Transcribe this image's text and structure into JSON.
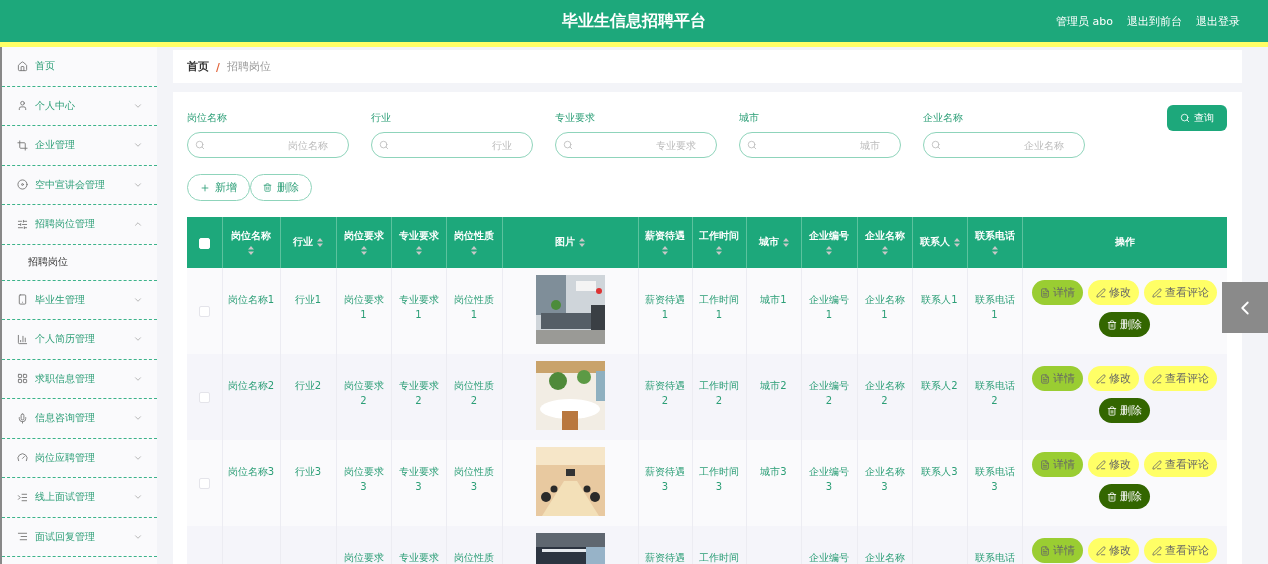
{
  "header": {
    "title": "毕业生信息招聘平台",
    "links": [
      "管理员 abo",
      "退出到前台",
      "退出登录"
    ]
  },
  "sidebar": {
    "items": [
      {
        "label": "首页",
        "kind": "link"
      },
      {
        "label": "个人中心",
        "kind": "group",
        "expanded": false
      },
      {
        "label": "企业管理",
        "kind": "group",
        "expanded": false
      },
      {
        "label": "空中宣讲会管理",
        "kind": "group",
        "expanded": false
      },
      {
        "label": "招聘岗位管理",
        "kind": "group",
        "expanded": true,
        "children": [
          {
            "label": "招聘岗位",
            "selected": true
          }
        ]
      },
      {
        "label": "毕业生管理",
        "kind": "group",
        "expanded": false
      },
      {
        "label": "个人简历管理",
        "kind": "group",
        "expanded": false
      },
      {
        "label": "求职信息管理",
        "kind": "group",
        "expanded": false
      },
      {
        "label": "信息咨询管理",
        "kind": "group",
        "expanded": false
      },
      {
        "label": "岗位应聘管理",
        "kind": "group",
        "expanded": false
      },
      {
        "label": "线上面试管理",
        "kind": "group",
        "expanded": false
      },
      {
        "label": "面试回复管理",
        "kind": "group",
        "expanded": false
      }
    ]
  },
  "breadcrumb": [
    "首页",
    "/",
    "招聘岗位"
  ],
  "search": {
    "fields": [
      {
        "label": "岗位名称",
        "placeholder": "岗位名称"
      },
      {
        "label": "行业",
        "placeholder": "行业"
      },
      {
        "label": "专业要求",
        "placeholder": "专业要求"
      },
      {
        "label": "城市",
        "placeholder": "城市"
      },
      {
        "label": "企业名称",
        "placeholder": "企业名称"
      }
    ],
    "button": "查询"
  },
  "toolbar": [
    {
      "label": "新增",
      "kind": "add"
    },
    {
      "label": "删除",
      "kind": "delete"
    }
  ],
  "table": {
    "select_all": {
      "checked": false
    },
    "columns": [
      {
        "label": "岗位名称",
        "sortable": true
      },
      {
        "label": "行业",
        "sortable": true
      },
      {
        "label": "岗位要求",
        "sortable": true
      },
      {
        "label": "专业要求",
        "sortable": true
      },
      {
        "label": "岗位性质",
        "sortable": true
      },
      {
        "label": "图片",
        "sortable": true,
        "kind": "picture"
      },
      {
        "label": "薪资待遇",
        "sortable": true
      },
      {
        "label": "工作时间",
        "sortable": true
      },
      {
        "label": "城市",
        "sortable": true
      },
      {
        "label": "企业编号",
        "sortable": true
      },
      {
        "label": "企业名称",
        "sortable": true
      },
      {
        "label": "联系人",
        "sortable": true
      },
      {
        "label": "联系电话",
        "sortable": true
      },
      {
        "label": "操作",
        "sortable": false,
        "kind": "actions"
      }
    ],
    "rows": [
      {
        "checked": false,
        "cells": [
          "岗位名称1",
          "行业1",
          "岗位要求1",
          "专业要求1",
          "岗位性质1",
          {
            "kind": "picture"
          },
          "薪资待遇1",
          "工作时间1",
          "城市1",
          "企业编号1",
          "企业名称1",
          "联系人1",
          "联系电话1"
        ],
        "actions": [
          {
            "label": "详情",
            "kind": "detail"
          },
          {
            "label": "修改",
            "kind": "edit"
          },
          {
            "label": "查看评论",
            "kind": "edit"
          },
          {
            "label": "删除",
            "kind": "delete"
          }
        ]
      },
      {
        "checked": false,
        "cells": [
          "岗位名称2",
          "行业2",
          "岗位要求2",
          "专业要求2",
          "岗位性质2",
          {
            "kind": "picture"
          },
          "薪资待遇2",
          "工作时间2",
          "城市2",
          "企业编号2",
          "企业名称2",
          "联系人2",
          "联系电话2"
        ],
        "actions": [
          {
            "label": "详情",
            "kind": "detail"
          },
          {
            "label": "修改",
            "kind": "edit"
          },
          {
            "label": "查看评论",
            "kind": "edit"
          },
          {
            "label": "删除",
            "kind": "delete"
          }
        ]
      },
      {
        "checked": false,
        "cells": [
          "岗位名称3",
          "行业3",
          "岗位要求3",
          "专业要求3",
          "岗位性质3",
          {
            "kind": "picture"
          },
          "薪资待遇3",
          "工作时间3",
          "城市3",
          "企业编号3",
          "企业名称3",
          "联系人3",
          "联系电话3"
        ],
        "actions": [
          {
            "label": "详情",
            "kind": "detail"
          },
          {
            "label": "修改",
            "kind": "edit"
          },
          {
            "label": "查看评论",
            "kind": "edit"
          },
          {
            "label": "删除",
            "kind": "delete"
          }
        ]
      },
      {
        "cells": [
          "",
          "",
          "岗位要求",
          "专业要求",
          "岗位性质",
          {
            "kind": "picture"
          },
          "薪资待遇",
          "工作时间",
          "",
          "企业编号",
          "企业名称",
          "",
          "联系电话"
        ],
        "actions": [
          {
            "label": "详情",
            "kind": "detail"
          },
          {
            "label": "修改",
            "kind": "edit"
          },
          {
            "label": "查看评论",
            "kind": "edit"
          }
        ]
      }
    ]
  }
}
